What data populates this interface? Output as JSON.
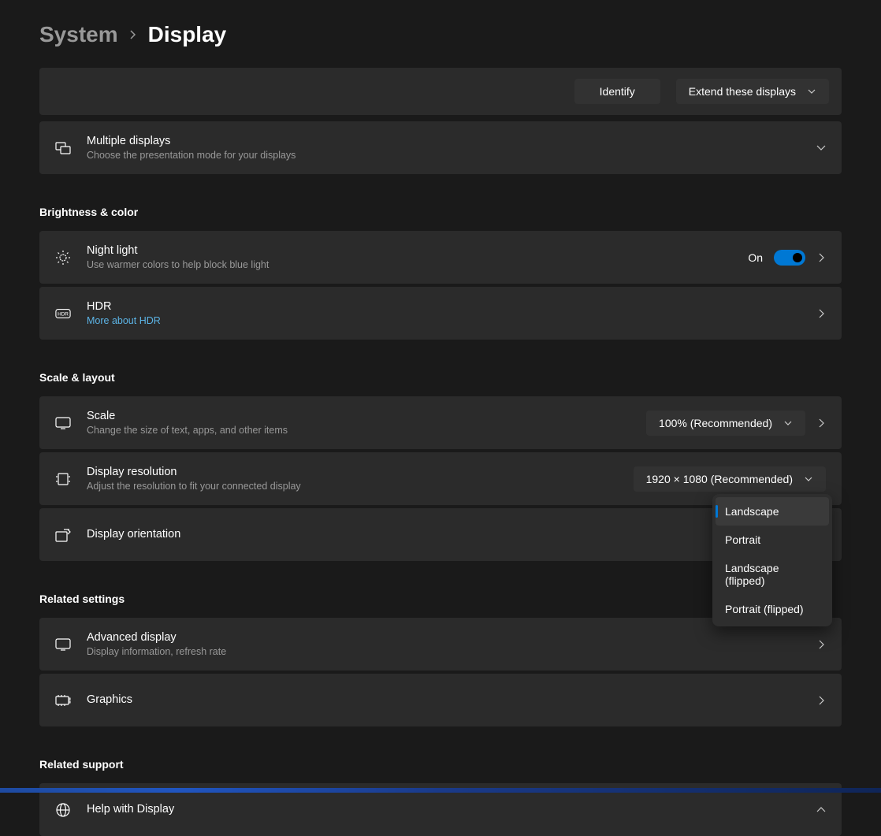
{
  "breadcrumb": {
    "parent": "System",
    "current": "Display"
  },
  "topActions": {
    "identify": "Identify",
    "extend": "Extend these displays"
  },
  "multipleDisplays": {
    "title": "Multiple displays",
    "sub": "Choose the presentation mode for your displays"
  },
  "sections": {
    "brightness": "Brightness & color",
    "scale": "Scale & layout",
    "related": "Related settings",
    "support": "Related support"
  },
  "nightLight": {
    "title": "Night light",
    "sub": "Use warmer colors to help block blue light",
    "state": "On"
  },
  "hdr": {
    "title": "HDR",
    "link": "More about HDR"
  },
  "scale": {
    "title": "Scale",
    "sub": "Change the size of text, apps, and other items",
    "value": "100% (Recommended)"
  },
  "resolution": {
    "title": "Display resolution",
    "sub": "Adjust the resolution to fit your connected display",
    "value": "1920 × 1080 (Recommended)"
  },
  "orientation": {
    "title": "Display orientation",
    "options": [
      "Landscape",
      "Portrait",
      "Landscape (flipped)",
      "Portrait (flipped)"
    ]
  },
  "advanced": {
    "title": "Advanced display",
    "sub": "Display information, refresh rate"
  },
  "graphics": {
    "title": "Graphics"
  },
  "help": {
    "title": "Help with Display"
  }
}
